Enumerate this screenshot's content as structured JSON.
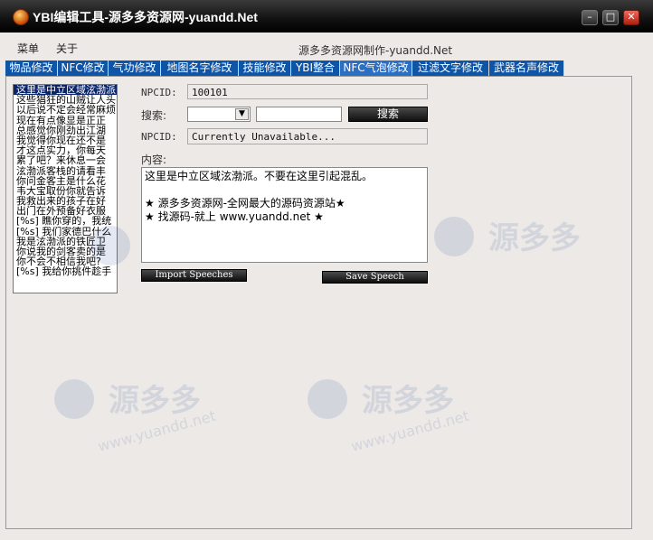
{
  "window": {
    "title": "YBI编辑工具-源多多资源网-yuandd.Net",
    "minimize_glyph": "–",
    "maximize_glyph": "□",
    "close_glyph": "✕"
  },
  "menu": {
    "items": [
      "菜单",
      "关于"
    ],
    "credit": "源多多资源网制作-yuandd.Net"
  },
  "tabs": [
    "物品修改",
    "NFC修改",
    "气功修改",
    "地图名字修改",
    "技能修改",
    "YBI整合",
    "NFC气泡修改",
    "过滤文字修改",
    "武器名声修改"
  ],
  "active_tab": "NFC气泡修改",
  "speech_list": {
    "items": [
      "这里是中立区域泫渤派",
      "这些猖狂的山贼让人头",
      "以后说不定会经常麻烦",
      "现在有点像显是正正",
      "总感觉你刚劲出江湖",
      "我觉得你现在还不是",
      "才这点实力，你每天",
      "累了吧？来休息一会",
      "泫渤派客栈的请看丰",
      "你问金客主是什么花",
      "韦大宝取份你就告诉",
      "我救出来的孩子在好",
      "出门在外预备好衣服",
      "[%s] 瞧你穿的，我统",
      "[%s] 我们家德巴什么",
      "我是泫渤派的铁匠卫",
      "你说我的剑客卖的是",
      "你不会不相信我吧?",
      "[%s] 我给你挑件趁手"
    ]
  },
  "form": {
    "npcid_label": "NPCID:",
    "npcid_value": "100101",
    "search_label": "搜索:",
    "search_combo_value": "",
    "search_input_value": "",
    "search_button": "搜索",
    "npcid2_label": "NPCID:",
    "npcid2_value": "Currently Unavailable...",
    "content_label": "内容:",
    "content_lines": [
      "这里是中立区域泫渤派。不要在这里引起混乱。",
      "",
      "★ 源多多资源网-全网最大的源码资源站★",
      "    ★ 找源码-就上 www.yuandd.net ★"
    ],
    "import_button": "Import Speeches",
    "save_button": "Save Speech"
  },
  "watermark": {
    "brand": "源多多",
    "url": "www.yuandd.net"
  }
}
